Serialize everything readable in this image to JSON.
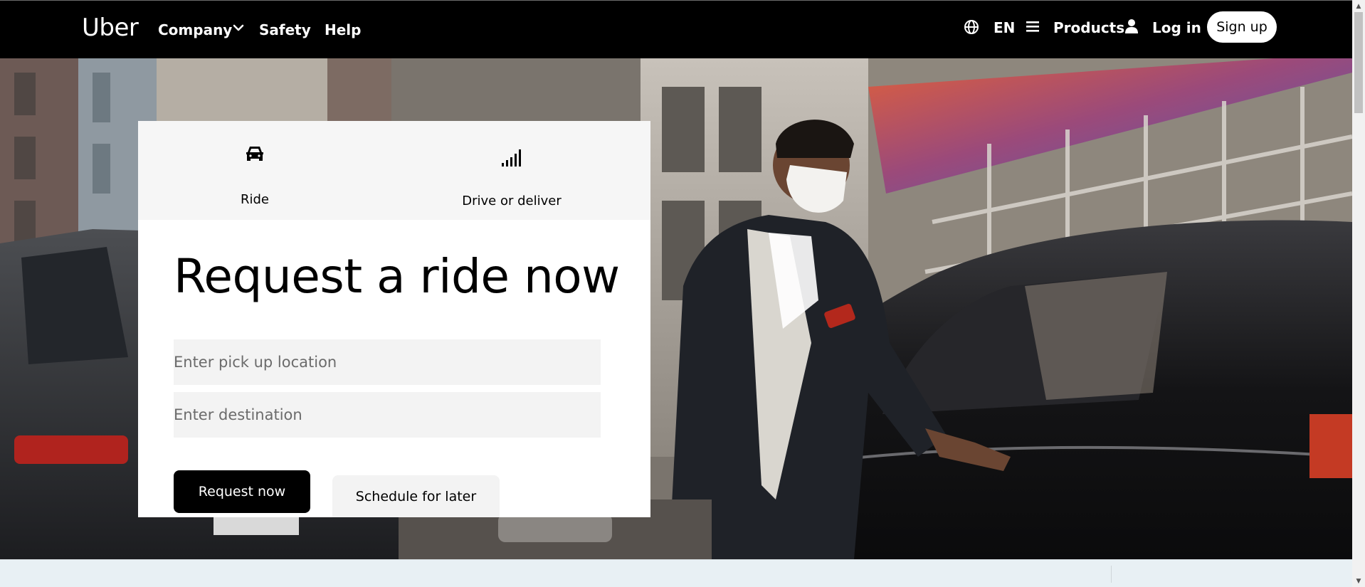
{
  "nav": {
    "logo": "Uber",
    "links": {
      "company": "Company",
      "safety": "Safety",
      "help": "Help",
      "language": "EN",
      "products": "Products",
      "login": "Log in",
      "signup": "Sign up"
    },
    "icons": [
      "chevron-down-icon",
      "globe-icon",
      "menu-icon",
      "person-icon"
    ]
  },
  "card": {
    "tabs": [
      {
        "label": "Ride",
        "icon": "car-icon"
      },
      {
        "label": "Drive or deliver",
        "icon": "signal-bars-icon"
      }
    ],
    "title": "Request a ride now",
    "pickup_placeholder": "Enter pick up location",
    "destination_placeholder": "Enter destination",
    "request_button": "Request now",
    "schedule_button": "Schedule for later"
  },
  "colors": {
    "nav_bg": "#000000",
    "card_bg": "#ffffff",
    "tabs_bg": "#f6f6f6",
    "field_bg": "#f3f3f3",
    "primary_button": "#000000"
  }
}
